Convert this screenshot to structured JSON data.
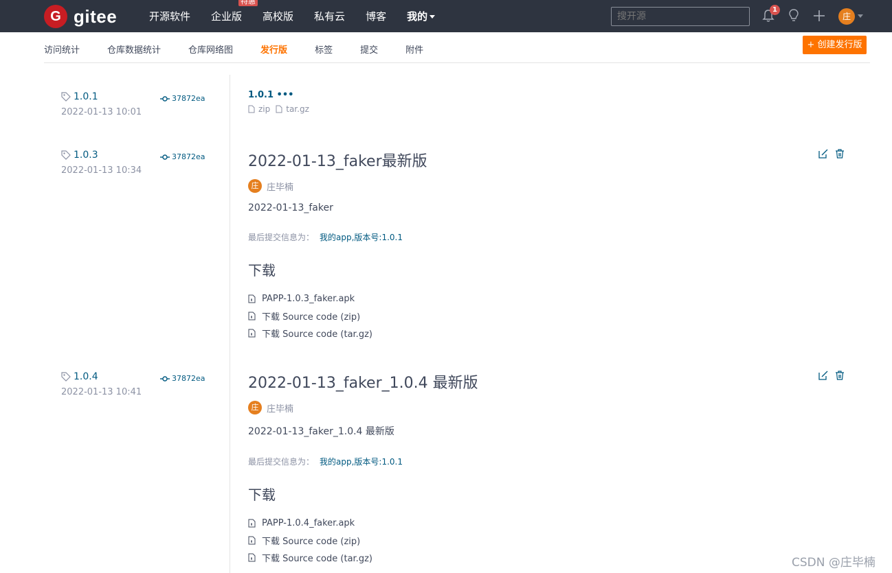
{
  "brand": {
    "logo_letter": "G",
    "name": "gitee"
  },
  "nav": {
    "items": [
      "开源软件",
      "企业版",
      "高校版",
      "私有云",
      "博客",
      "我的"
    ],
    "promo_badge": "特惠",
    "search_placeholder": "搜开源",
    "notification_count": "1",
    "user_initial": "庄"
  },
  "subtabs": [
    "访问统计",
    "仓库数据统计",
    "仓库网络图",
    "发行版",
    "标签",
    "提交",
    "附件"
  ],
  "active_subtab": "发行版",
  "create_button": "+ 创建发行版",
  "releases": [
    {
      "tag": "1.0.1",
      "commit": "37872ea",
      "date": "2022-01-13 10:01",
      "collapsed": true,
      "small_title": "1.0.1 •••",
      "files": [
        "zip",
        "tar.gz"
      ]
    },
    {
      "tag": "1.0.3",
      "commit": "37872ea",
      "date": "2022-01-13 10:34",
      "title": "2022-01-13_faker最新版",
      "author": "庄毕楠",
      "author_initial": "庄",
      "description": "2022-01-13_faker",
      "last_commit_label": "最后提交信息为：",
      "last_commit_msg": "我的app,版本号:1.0.1",
      "download_heading": "下载",
      "downloads": [
        "PAPP-1.0.3_faker.apk",
        "下载 Source code (zip)",
        "下载 Source code (tar.gz)"
      ]
    },
    {
      "tag": "1.0.4",
      "commit": "37872ea",
      "date": "2022-01-13 10:41",
      "title": "2022-01-13_faker_1.0.4 最新版",
      "author": "庄毕楠",
      "author_initial": "庄",
      "description": "2022-01-13_faker_1.0.4 最新版",
      "last_commit_label": "最后提交信息为：",
      "last_commit_msg": "我的app,版本号:1.0.1",
      "download_heading": "下载",
      "downloads": [
        "PAPP-1.0.4_faker.apk",
        "下载 Source code (zip)",
        "下载 Source code (tar.gz)"
      ]
    }
  ],
  "watermark": "CSDN @庄毕楠",
  "colors": {
    "nav_bg": "#2e3440",
    "accent": "#fe7300",
    "link": "#005980",
    "avatar": "#e57f1f",
    "badge": "#d9534f"
  }
}
